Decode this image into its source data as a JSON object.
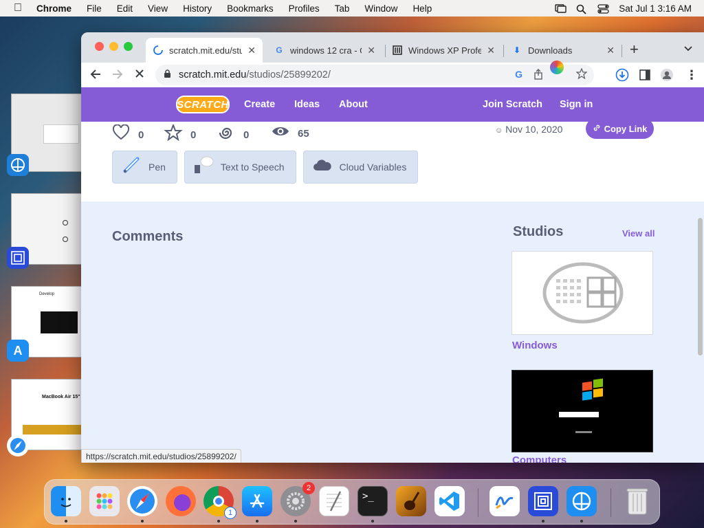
{
  "menubar": {
    "app": "Chrome",
    "items": [
      "File",
      "Edit",
      "View",
      "History",
      "Bookmarks",
      "Profiles",
      "Tab",
      "Window",
      "Help"
    ],
    "clock": "Sat Jul 1  3:16 AM"
  },
  "browser": {
    "tabs": [
      {
        "title": "scratch.mit.edu/stu",
        "icon": "loading-spinner-icon",
        "active": true
      },
      {
        "title": "windows 12 cra - G",
        "icon": "google-icon",
        "active": false
      },
      {
        "title": "Windows XP Profe",
        "icon": "archive-icon",
        "active": false
      },
      {
        "title": "Downloads",
        "icon": "download-icon",
        "active": false
      }
    ],
    "new_tab": "+",
    "url_host": "scratch.mit.edu",
    "url_path": "/studios/25899202/",
    "status_url": "https://scratch.mit.edu/studios/25899202/"
  },
  "scratch": {
    "nav": {
      "logo": "SCRATCH",
      "create": "Create",
      "ideas": "Ideas",
      "about": "About",
      "join": "Join Scratch",
      "signin": "Sign in"
    },
    "stats": {
      "loves": "0",
      "favorites": "0",
      "remixes": "0",
      "views": "65"
    },
    "date": "Nov 10, 2020",
    "copy_link": "Copy Link",
    "extensions": [
      "Pen",
      "Text to Speech",
      "Cloud Variables"
    ],
    "comments_heading": "Comments",
    "studios_heading": "Studios",
    "view_all": "View all",
    "studios": [
      {
        "title": "Windows"
      },
      {
        "title": "Computers"
      }
    ]
  },
  "colors": {
    "scratch_purple": "#855cd6",
    "scratch_orange": "#ffab19"
  }
}
